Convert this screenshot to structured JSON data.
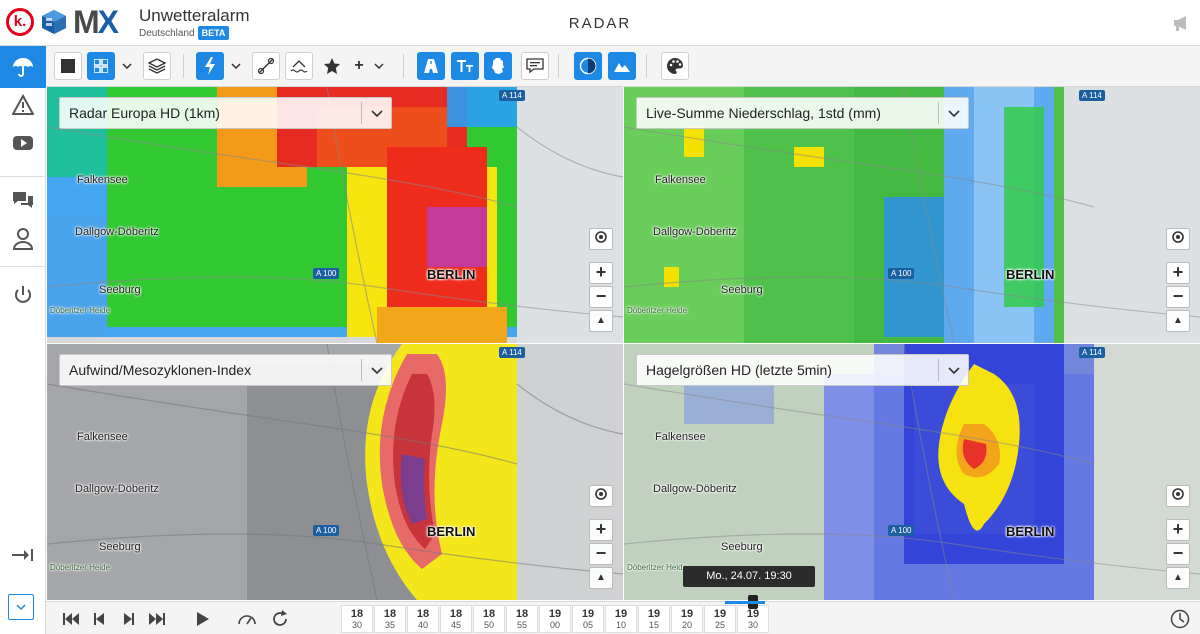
{
  "header": {
    "logo_k": "k.",
    "logo_mx_a": "M",
    "logo_mx_b": "X",
    "brand_name": "Unwetteralarm",
    "brand_sub": "Deutschland",
    "beta": "BETA",
    "page_title": "RADAR"
  },
  "sidebar": {
    "items": [
      "umbrella-icon",
      "warning-icon",
      "video-icon",
      "chat-icon",
      "user-icon",
      "power-icon"
    ],
    "active": "umbrella-icon"
  },
  "toolbar": {
    "plus_label": "+"
  },
  "panels": [
    {
      "layer": "Radar Europa HD (1km)"
    },
    {
      "layer": "Live-Summe Niederschlag, 1std (mm)"
    },
    {
      "layer": "Aufwind/Mesozyklonen-Index"
    },
    {
      "layer": "Hagelgrößen HD (letzte 5min)"
    }
  ],
  "map_labels": {
    "falkensee": "Falkensee",
    "dallgow": "Dallgow-Döberitz",
    "seeburg": "Seeburg",
    "heide": "Döberitzer Heide",
    "berlin": "BERLIN",
    "a100": "A 100",
    "a114": "A 114"
  },
  "map_controls": {
    "zoom_in": "+",
    "zoom_out": "−",
    "north": "▲"
  },
  "timeline": {
    "slots": [
      {
        "h": "18",
        "m": "30"
      },
      {
        "h": "18",
        "m": "35"
      },
      {
        "h": "18",
        "m": "40"
      },
      {
        "h": "18",
        "m": "45"
      },
      {
        "h": "18",
        "m": "50"
      },
      {
        "h": "18",
        "m": "55"
      },
      {
        "h": "19",
        "m": "00"
      },
      {
        "h": "19",
        "m": "05"
      },
      {
        "h": "19",
        "m": "10"
      },
      {
        "h": "19",
        "m": "15"
      },
      {
        "h": "19",
        "m": "20"
      },
      {
        "h": "19",
        "m": "25"
      },
      {
        "h": "19",
        "m": "30"
      }
    ],
    "tooltip": "Mo., 24.07. 19:30",
    "selected_index": 12
  },
  "colors": {
    "accent": "#1e88e5",
    "brand_red": "#e2001a"
  }
}
